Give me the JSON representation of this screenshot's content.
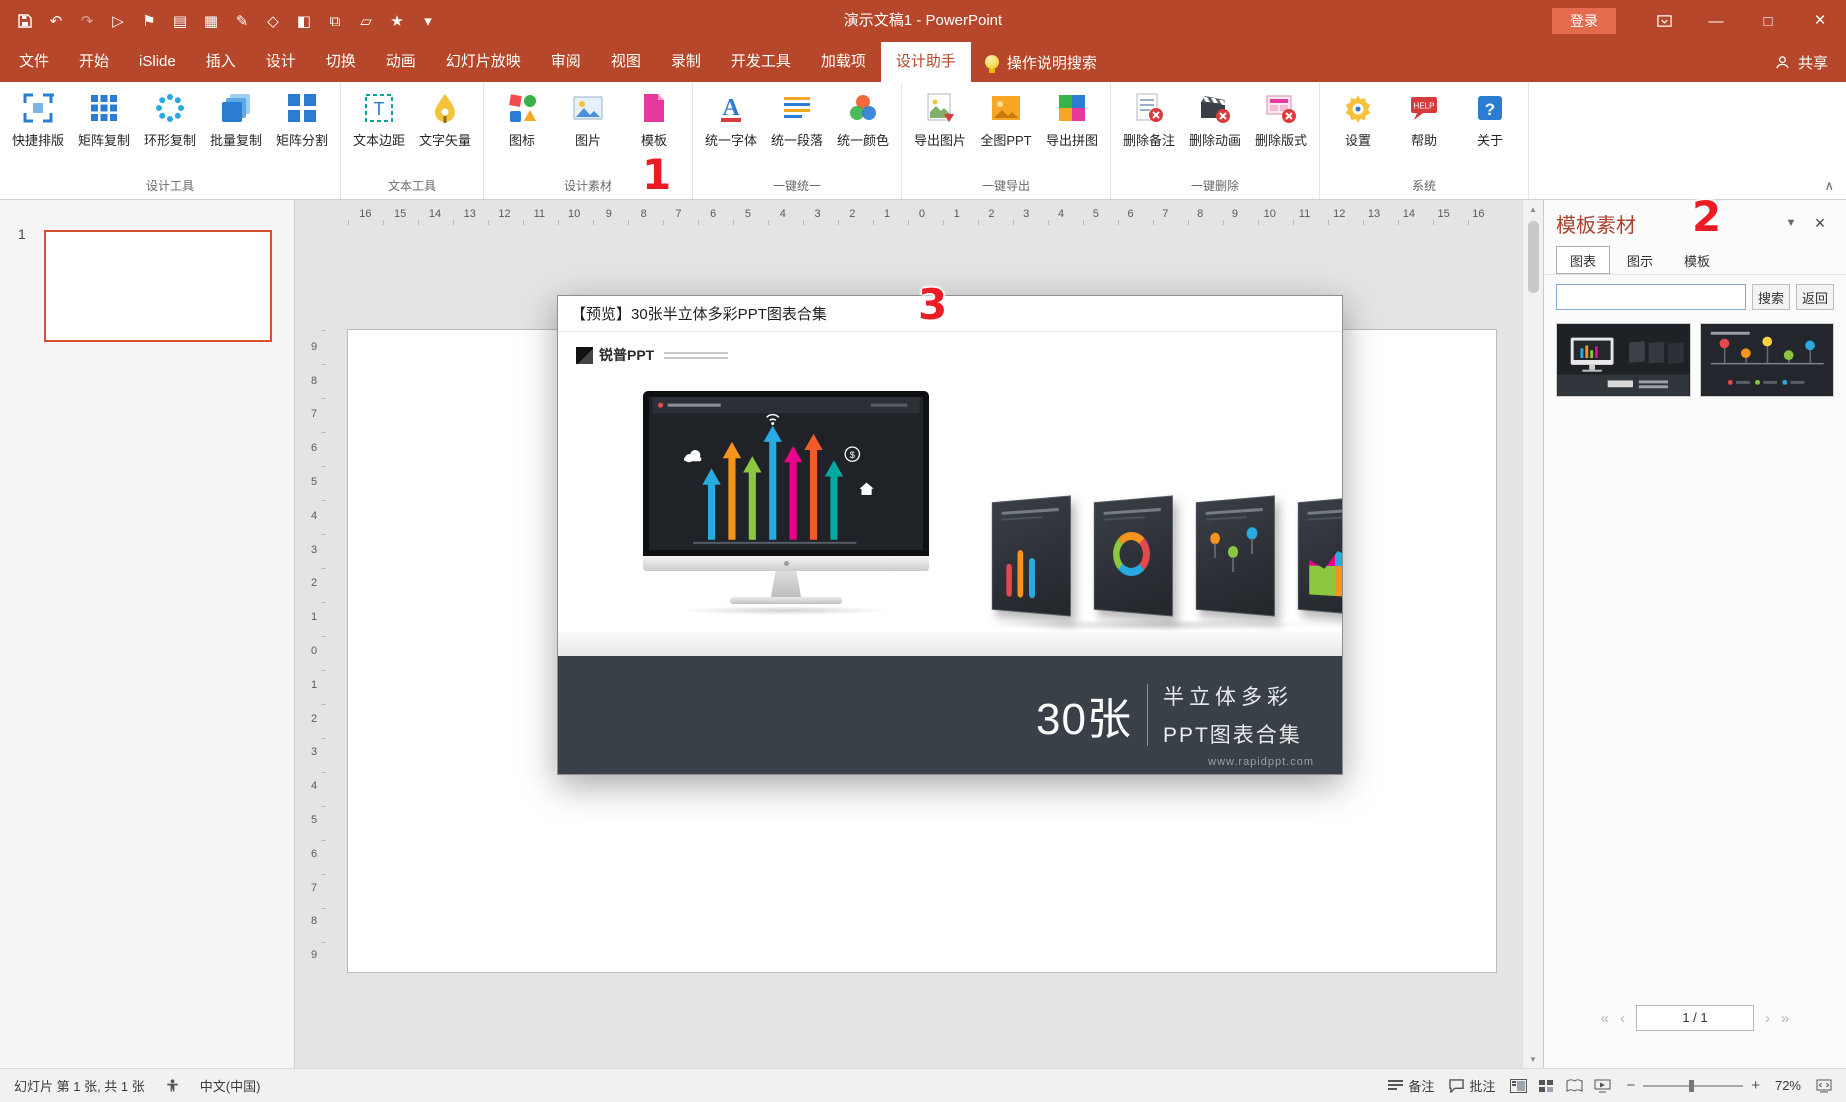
{
  "app": {
    "title": "演示文稿1 - PowerPoint",
    "login_label": "登录",
    "share_label": "共享",
    "search_help_label": "操作说明搜索"
  },
  "qat_icons": [
    {
      "name": "save"
    },
    {
      "name": "undo"
    },
    {
      "name": "redo",
      "dim": true
    },
    {
      "name": "start-slideshow"
    },
    {
      "name": "flag"
    },
    {
      "name": "new-file"
    },
    {
      "name": "table"
    },
    {
      "name": "pen"
    },
    {
      "name": "shape"
    },
    {
      "name": "chart"
    },
    {
      "name": "clipboard"
    },
    {
      "name": "folder"
    },
    {
      "name": "star"
    },
    {
      "name": "more-commands"
    }
  ],
  "menu_tabs": [
    {
      "name": "file",
      "label": "文件"
    },
    {
      "name": "home",
      "label": "开始"
    },
    {
      "name": "islide",
      "label": "iSlide"
    },
    {
      "name": "insert",
      "label": "插入"
    },
    {
      "name": "design",
      "label": "设计"
    },
    {
      "name": "transitions",
      "label": "切换"
    },
    {
      "name": "animations",
      "label": "动画"
    },
    {
      "name": "slide-show",
      "label": "幻灯片放映"
    },
    {
      "name": "review",
      "label": "审阅"
    },
    {
      "name": "view",
      "label": "视图"
    },
    {
      "name": "record",
      "label": "录制"
    },
    {
      "name": "developer",
      "label": "开发工具"
    },
    {
      "name": "add-ins",
      "label": "加载项"
    },
    {
      "name": "design-assistant",
      "label": "设计助手",
      "active": true
    }
  ],
  "ribbon": {
    "groups": [
      {
        "name": "design-tools",
        "label": "设计工具",
        "buttons": [
          {
            "name": "quick-layout",
            "label": "快捷排版",
            "icon": "quick-layout"
          },
          {
            "name": "matrix-copy",
            "label": "矩阵复制",
            "icon": "matrix-copy"
          },
          {
            "name": "ring-copy",
            "label": "环形复制",
            "icon": "ring-copy"
          },
          {
            "name": "batch-copy",
            "label": "批量复制",
            "icon": "batch-copy"
          },
          {
            "name": "matrix-split",
            "label": "矩阵分割",
            "icon": "matrix-split"
          }
        ]
      },
      {
        "name": "text-tools",
        "label": "文本工具",
        "buttons": [
          {
            "name": "text-margin",
            "label": "文本边距",
            "icon": "text-margin"
          },
          {
            "name": "text-vector",
            "label": "文字矢量",
            "icon": "text-vector"
          }
        ]
      },
      {
        "name": "design-assets",
        "label": "设计素材",
        "buttons": [
          {
            "name": "icon-lib",
            "label": "图标",
            "icon": "icon-lib"
          },
          {
            "name": "picture-lib",
            "label": "图片",
            "icon": "picture-lib"
          },
          {
            "name": "template-lib",
            "label": "模板",
            "icon": "template-lib"
          }
        ]
      },
      {
        "name": "one-key-unify",
        "label": "一键统一",
        "buttons": [
          {
            "name": "unify-font",
            "label": "统一字体",
            "icon": "unify-font"
          },
          {
            "name": "unify-paragraph",
            "label": "统一段落",
            "icon": "unify-paragraph"
          },
          {
            "name": "unify-color",
            "label": "统一颜色",
            "icon": "unify-color"
          }
        ]
      },
      {
        "name": "one-key-export",
        "label": "一键导出",
        "buttons": [
          {
            "name": "export-image",
            "label": "导出图片",
            "icon": "export-image"
          },
          {
            "name": "export-fullppt",
            "label": "全图PPT",
            "icon": "export-fullppt"
          },
          {
            "name": "export-puzzle",
            "label": "导出拼图",
            "icon": "export-puzzle"
          }
        ]
      },
      {
        "name": "one-key-delete",
        "label": "一键删除",
        "buttons": [
          {
            "name": "delete-notes",
            "label": "删除备注",
            "icon": "delete-notes"
          },
          {
            "name": "delete-animation",
            "label": "删除动画",
            "icon": "delete-animation"
          },
          {
            "name": "delete-layout",
            "label": "删除版式",
            "icon": "delete-layout"
          }
        ]
      },
      {
        "name": "system",
        "label": "系统",
        "buttons": [
          {
            "name": "settings",
            "label": "设置",
            "icon": "settings"
          },
          {
            "name": "help",
            "label": "帮助",
            "icon": "help"
          },
          {
            "name": "about",
            "label": "关于",
            "icon": "about"
          }
        ]
      }
    ]
  },
  "rulers": {
    "horizontal": [
      "16",
      "15",
      "14",
      "13",
      "12",
      "11",
      "10",
      "9",
      "8",
      "7",
      "6",
      "5",
      "4",
      "3",
      "2",
      "1",
      "0",
      "1",
      "2",
      "3",
      "4",
      "5",
      "6",
      "7",
      "8",
      "9",
      "10",
      "11",
      "12",
      "13",
      "14",
      "15",
      "16"
    ],
    "vertical": [
      "9",
      "8",
      "7",
      "6",
      "5",
      "4",
      "3",
      "2",
      "1",
      "0",
      "1",
      "2",
      "3",
      "4",
      "5",
      "6",
      "7",
      "8",
      "9"
    ]
  },
  "slide_panel": {
    "slide_number": "1"
  },
  "dialog": {
    "title": "【预览】30张半立体多彩PPT图表合集",
    "logo_text": "锐普PPT",
    "banner": {
      "count": "30张",
      "line1": "半立体多彩",
      "line2": "PPT图表合集",
      "url": "www.rapidppt.com"
    }
  },
  "right_panel": {
    "title": "模板素材",
    "tabs": [
      {
        "name": "charts",
        "label": "图表",
        "active": true
      },
      {
        "name": "diagrams",
        "label": "图示"
      },
      {
        "name": "templates",
        "label": "模板"
      }
    ],
    "search_label": "搜索",
    "back_label": "返回",
    "pagination": "1 / 1"
  },
  "status_bar": {
    "slide_info": "幻灯片 第 1 张, 共 1 张",
    "language": "中文(中国)",
    "notes_label": "备注",
    "comments_label": "批注",
    "zoom_level": "72%"
  },
  "annotations": {
    "one": "1",
    "two": "2",
    "three": "3"
  },
  "colors": {
    "titlebar": "#B7472A",
    "login_button": "#E56B4F",
    "annotation_red": "#ED1C24",
    "selected_slide_border": "#D4502E",
    "banner_dark": "#3A4048"
  }
}
